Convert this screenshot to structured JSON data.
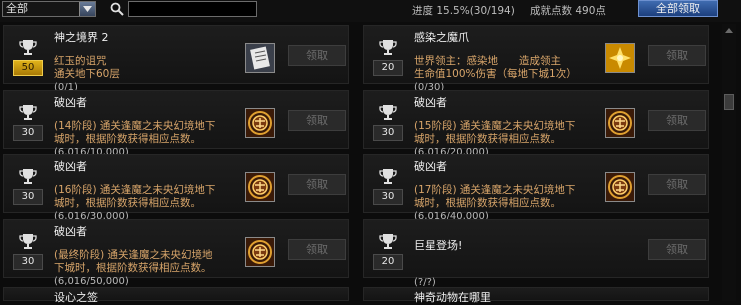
{
  "toolbar": {
    "category_value": "全部",
    "progress_label": "进度",
    "progress_value": "15.5%(30/194)",
    "points_label": "成就点数",
    "points_value": "490点",
    "claim_all_label": "全部领取"
  },
  "achievements": [
    {
      "title": "神之境界 2",
      "desc": "红玉的诅咒\n通关地下60层",
      "count": "(0/1)",
      "points": "50",
      "gold": true,
      "reward": "scroll-icon",
      "claim": "领取"
    },
    {
      "title": "感染之魔爪",
      "desc": "世界领主：感染地　　造成领主\n生命值100%伤害（每地下城1次）",
      "count": "(0/30)",
      "points": "20",
      "gold": false,
      "reward": "crystal-icon",
      "claim": "领取"
    },
    {
      "title": "破凶者",
      "desc": "(14阶段) 通关逢魔之未央幻境地下\n城时，根据阶数获得相应点数。",
      "count": "(6,016/10,000)",
      "points": "30",
      "gold": false,
      "reward": "emblem-icon",
      "claim": "领取"
    },
    {
      "title": "破凶者",
      "desc": "(15阶段) 通关逢魔之未央幻境地下\n城时，根据阶数获得相应点数。",
      "count": "(6,016/20,000)",
      "points": "30",
      "gold": false,
      "reward": "emblem-icon",
      "claim": "领取"
    },
    {
      "title": "破凶者",
      "desc": "(16阶段) 通关逢魔之未央幻境地下\n城时，根据阶数获得相应点数。",
      "count": "(6,016/30,000)",
      "points": "30",
      "gold": false,
      "reward": "emblem-icon",
      "claim": "领取"
    },
    {
      "title": "破凶者",
      "desc": "(17阶段) 通关逢魔之未央幻境地下\n城时，根据阶数获得相应点数。",
      "count": "(6,016/40,000)",
      "points": "30",
      "gold": false,
      "reward": "emblem-icon",
      "claim": "领取"
    },
    {
      "title": "破凶者",
      "desc": "(最终阶段) 通关逢魔之未央幻境地\n下城时，根据阶数获得相应点数。",
      "count": "(6,016/50,000)",
      "points": "30",
      "gold": false,
      "reward": "emblem-icon",
      "claim": "领取"
    },
    {
      "title": "巨星登场!",
      "desc": "",
      "count": "(?/?)",
      "points": "20",
      "gold": false,
      "reward": "",
      "claim": "领取"
    }
  ],
  "partial_row": {
    "left_title": "设心之签",
    "right_title": "神奇动物在哪里"
  },
  "colors": {
    "accent_blue": "#2d5aa0",
    "gold_badge": "#d4a017",
    "desc_orange": "#d8a56a"
  }
}
